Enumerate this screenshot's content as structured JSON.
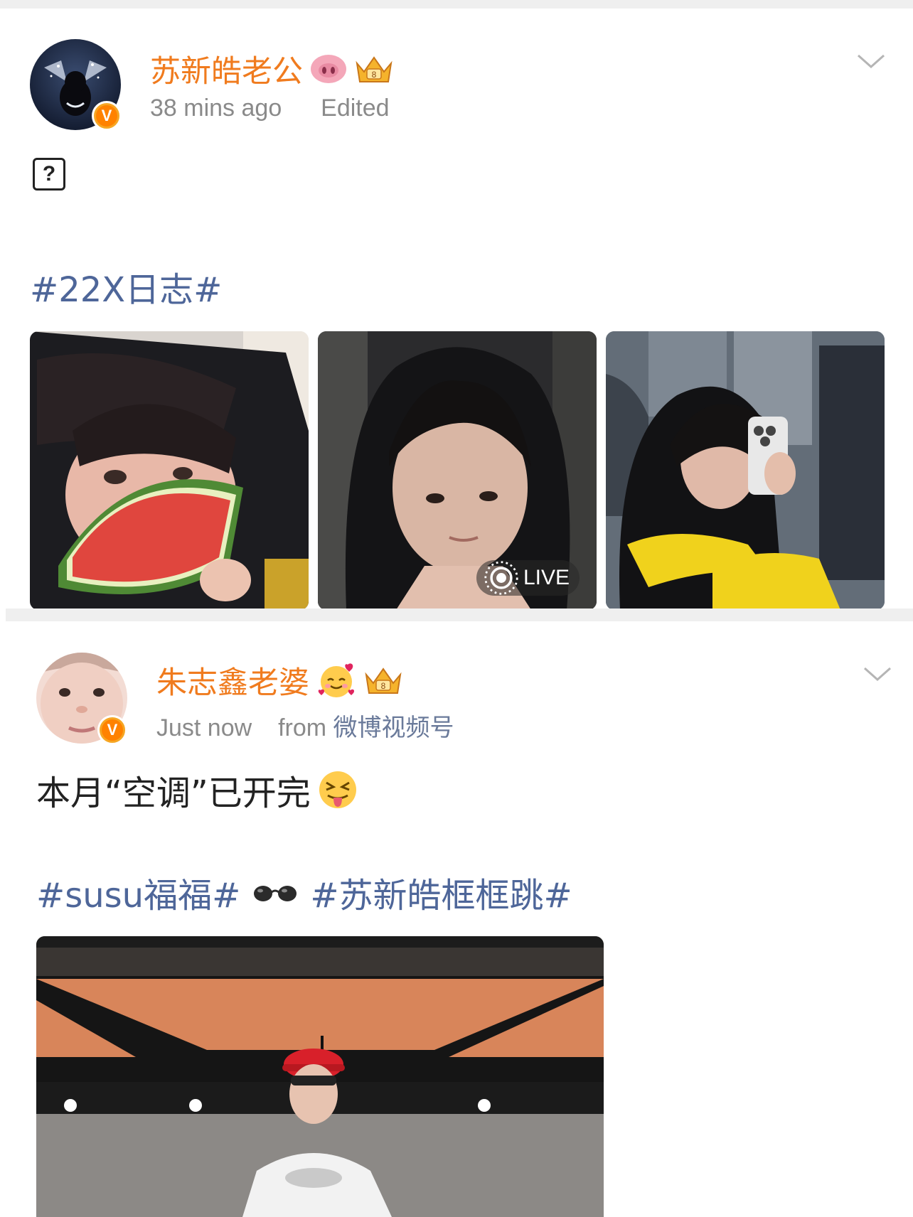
{
  "posts": [
    {
      "username": "苏新皓老公",
      "time": "38 mins ago",
      "edited": "Edited",
      "body_placeholder": "?",
      "hashtag": "#22X日志#",
      "live_label": "LIVE"
    },
    {
      "username": "朱志鑫老婆",
      "time": "Just now",
      "from_label": "from",
      "source": "微博视频号",
      "text": "本月“空调”已开完",
      "hashtags": [
        "#susu福福#",
        "#苏新皓框框跳#"
      ]
    }
  ],
  "icons": {
    "verified": "verified-v-badge",
    "crown": "crown-icon",
    "pig": "pig-face-icon",
    "smiling_hearts": "smiling-face-with-hearts-icon",
    "tongue": "squinting-tongue-face-icon",
    "glasses": "glasses-icon",
    "menu": "chevron-down-icon",
    "live": "live-photo-icon"
  },
  "colors": {
    "username": "#f07b1e",
    "hashtag": "#4e6699",
    "meta": "#8a8a8a",
    "verified": "#ff8200"
  }
}
